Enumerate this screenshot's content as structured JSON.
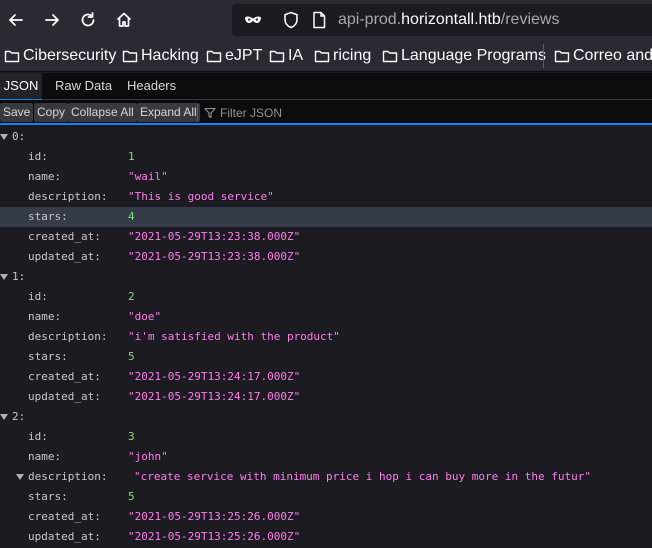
{
  "browser": {
    "url_prefix": "api-prod.",
    "url_host": "horizontall.htb",
    "url_path": "/reviews"
  },
  "bookmarks": [
    {
      "label": "Cibersecurity"
    },
    {
      "label": "Hacking"
    },
    {
      "label": "eJPT"
    },
    {
      "label": "IA"
    },
    {
      "label": "ricing"
    },
    {
      "label": "Language Programs"
    },
    {
      "label": "Correo and a"
    }
  ],
  "tabs": [
    {
      "label": "JSON"
    },
    {
      "label": "Raw Data"
    },
    {
      "label": "Headers"
    }
  ],
  "toolbar": {
    "save": "Save",
    "copy": "Copy",
    "collapse_all": "Collapse All",
    "expand_all": "Expand All",
    "filter_placeholder": "Filter JSON"
  },
  "reviews": [
    {
      "index": "0:",
      "id": {
        "key": "id:",
        "value": "1"
      },
      "name": {
        "key": "name:",
        "value": "\"wail\""
      },
      "description": {
        "key": "description:",
        "value": "\"This is good service\""
      },
      "stars": {
        "key": "stars:",
        "value": "4"
      },
      "created_at": {
        "key": "created_at:",
        "value": "\"2021-05-29T13:23:38.000Z\""
      },
      "updated_at": {
        "key": "updated_at:",
        "value": "\"2021-05-29T13:23:38.000Z\""
      }
    },
    {
      "index": "1:",
      "id": {
        "key": "id:",
        "value": "2"
      },
      "name": {
        "key": "name:",
        "value": "\"doe\""
      },
      "description": {
        "key": "description:",
        "value": "\"i'm satisfied with the product\""
      },
      "stars": {
        "key": "stars:",
        "value": "5"
      },
      "created_at": {
        "key": "created_at:",
        "value": "\"2021-05-29T13:24:17.000Z\""
      },
      "updated_at": {
        "key": "updated_at:",
        "value": "\"2021-05-29T13:24:17.000Z\""
      }
    },
    {
      "index": "2:",
      "id": {
        "key": "id:",
        "value": "3"
      },
      "name": {
        "key": "name:",
        "value": "\"john\""
      },
      "description": {
        "key": "description:",
        "value": "\"create service with minimum price i hop i can buy more in the futur\""
      },
      "stars": {
        "key": "stars:",
        "value": "5"
      },
      "created_at": {
        "key": "created_at:",
        "value": "\"2021-05-29T13:25:26.000Z\""
      },
      "updated_at": {
        "key": "updated_at:",
        "value": "\"2021-05-29T13:25:26.000Z\""
      }
    }
  ]
}
